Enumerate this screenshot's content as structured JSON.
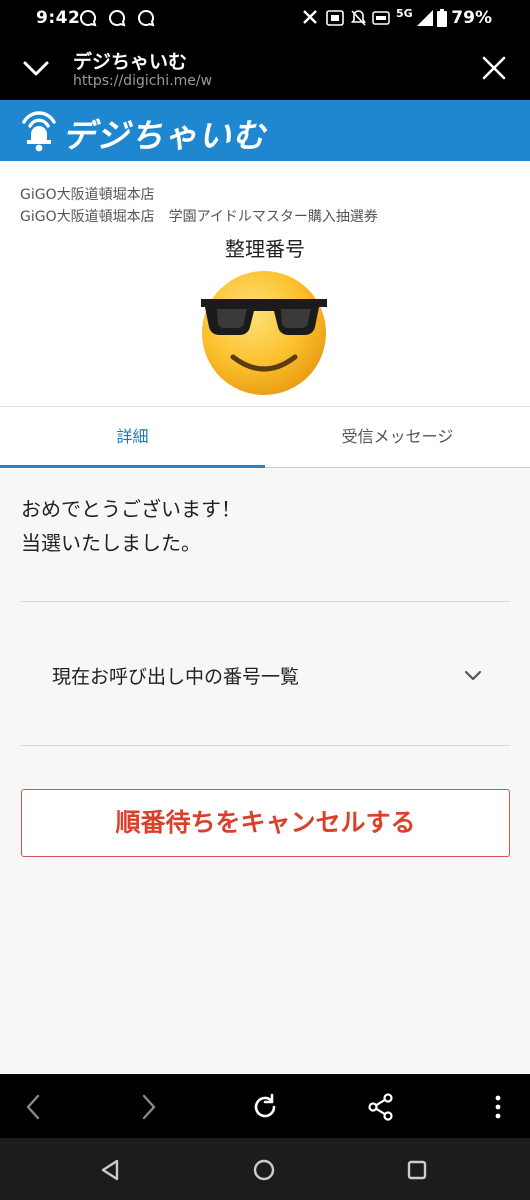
{
  "status_bar": {
    "time": "9:42",
    "notification_icons": [
      "chat-bubble-icon",
      "chat-bubble-icon",
      "chat-bubble-icon"
    ],
    "network": "5G",
    "battery": "79%"
  },
  "browser": {
    "page_title": "デジちゃいむ",
    "url": "https://digichi.me/w"
  },
  "brand": {
    "name": "デジちゃいむ",
    "color": "#1e87cf"
  },
  "store": {
    "name": "GiGO大阪道頓堀本店",
    "lottery": "GiGO大阪道頓堀本店　学園アイドルマスター購入抽選券",
    "ticket_heading": "整理番号",
    "status_emoji": "😎"
  },
  "tabs": [
    {
      "label": "詳細",
      "active": true
    },
    {
      "label": "受信メッセージ",
      "active": false
    }
  ],
  "content": {
    "congrats_line1": "おめでとうございます！",
    "congrats_line2": "当選いたしました。",
    "calling_list_label": "現在お呼び出し中の番号一覧",
    "cancel_label": "順番待ちをキャンセルする",
    "cancel_color": "#d9412c"
  },
  "toolbar": {
    "icons": [
      "back-icon",
      "forward-icon",
      "reload-icon",
      "share-icon",
      "more-icon"
    ]
  },
  "system_nav": {
    "icons": [
      "back-triangle-icon",
      "home-circle-icon",
      "recents-square-icon"
    ]
  }
}
